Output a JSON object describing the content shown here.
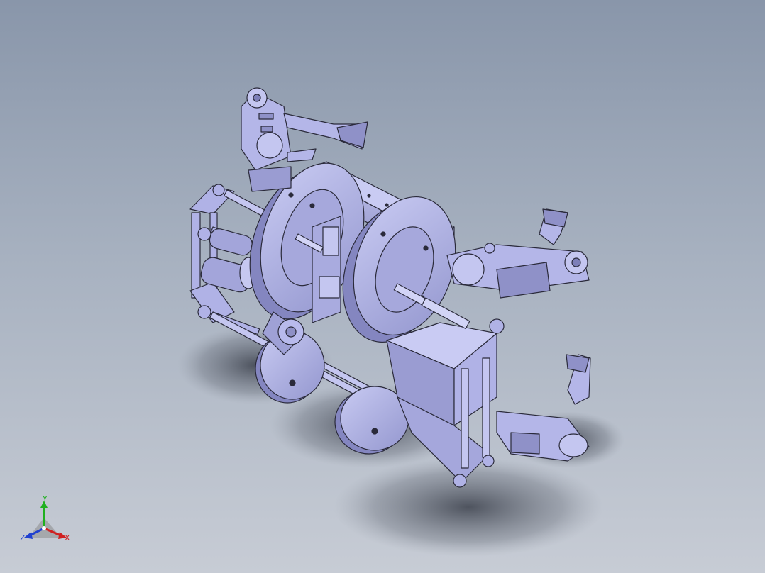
{
  "viewport": {
    "background_top": "#8996aa",
    "background_bottom": "#c7ccd5"
  },
  "model": {
    "description_icon": "robot-crawler-assembly-icon",
    "body_color": "#b4b6e8",
    "shade_color": "#8f91c8",
    "edge_color": "#2a2a3a"
  },
  "triad": {
    "x_label": "X",
    "y_label": "Y",
    "z_label": "Z",
    "x_color": "#d02020",
    "y_color": "#20b020",
    "z_color": "#2040d0"
  }
}
